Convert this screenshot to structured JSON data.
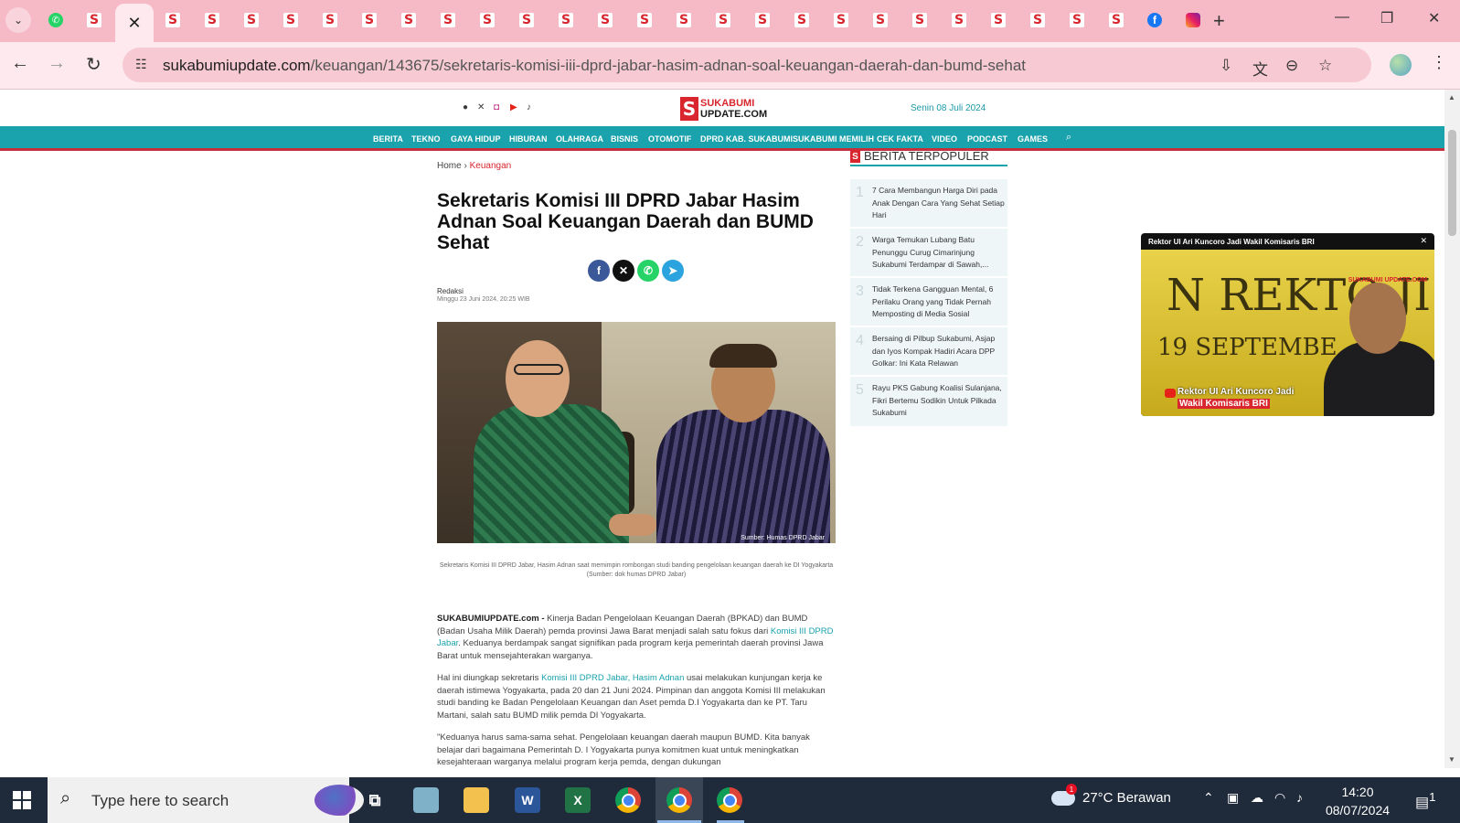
{
  "browser": {
    "url_domain": "sukabumiupdate.com",
    "url_path": "/keuangan/143675/sekretaris-komisi-iii-dprd-jabar-hasim-adnan-soal-keuangan-daerah-dan-bumd-sehat",
    "tab_icons": [
      "whatsapp-icon",
      "sukabumi-icon",
      "close-icon",
      "sukabumi-icon",
      "sukabumi-icon",
      "sukabumi-icon",
      "sukabumi-icon",
      "sukabumi-icon",
      "sukabumi-icon",
      "sukabumi-icon",
      "sukabumi-icon",
      "sukabumi-icon",
      "sukabumi-icon",
      "sukabumi-icon",
      "sukabumi-icon",
      "sukabumi-icon",
      "sukabumi-icon",
      "sukabumi-icon",
      "sukabumi-icon",
      "sukabumi-icon",
      "sukabumi-icon",
      "sukabumi-icon",
      "sukabumi-icon",
      "sukabumi-icon",
      "sukabumi-icon",
      "sukabumi-icon",
      "sukabumi-icon",
      "facebook-icon",
      "instagram-icon"
    ]
  },
  "site": {
    "logo_line1": "SUKABUMI",
    "logo_line2": "UPDATE.COM",
    "header_date": "Senin 08 Juli 2024",
    "nav": [
      "BERITA",
      "TEKNO",
      "GAYA HIDUP",
      "HIBURAN",
      "OLAHRAGA",
      "BISNIS",
      "OTOMOTIF",
      "DPRD KAB. SUKABUMI",
      "SUKABUMI MEMILIH",
      "CEK FAKTA",
      "VIDEO",
      "PODCAST",
      "GAMES"
    ]
  },
  "article": {
    "breadcrumb_home": "Home",
    "breadcrumb_sep": "›",
    "breadcrumb_current": "Keuangan",
    "title": "Sekretaris Komisi III DPRD Jabar Hasim Adnan Soal Keuangan Daerah dan BUMD Sehat",
    "author": "Redaksi",
    "date": "Minggu 23 Juni 2024, 20:25 WIB",
    "photo_credit": "Sumber: Humas DPRD Jabar",
    "caption": "Sekretaris Komisi III DPRD Jabar, Hasim Adnan saat memimpin rombongan studi banding pengelolaan keuangan daerah ke DI Yogyakarta (Sumber: dok humas DPRD Jabar)",
    "p1_lead": "SUKABUMIUPDATE.com -",
    "p1_a": " Kinerja Badan Pengelolaan Keuangan Daerah (BPKAD) dan BUMD (Badan Usaha Milik Daerah) pemda provinsi Jawa Barat menjadi salah satu fokus dari ",
    "p1_link": "Komisi III DPRD Jabar",
    "p1_b": ". Keduanya berdampak sangat signifikan pada program kerja pemerintah daerah provinsi Jawa Barat untuk mensejahterakan warganya.",
    "p2_a": "Hal ini diungkap sekretaris ",
    "p2_link1": "Komisi III DPRD Jabar",
    "p2_comma": ", ",
    "p2_link2": "Hasim Adnan",
    "p2_b": " usai melakukan kunjungan kerja ke daerah istimewa Yogyakarta, pada 20 dan 21 Juni 2024. Pimpinan dan anggota Komisi III melakukan studi banding ke Badan Pengelolaan Keuangan dan Aset pemda D.I Yogyakarta dan ke PT. Taru Martani, salah satu BUMD milik pemda DI Yogyakarta.",
    "p3": "\"Keduanya harus sama-sama sehat. Pengelolaan keuangan daerah maupun BUMD. Kita banyak belajar dari bagaimana Pemerintah D. I Yogyakarta punya komitmen kuat untuk meningkatkan kesejahteraan warganya melalui program kerja pemda, dengan dukungan"
  },
  "sidebar": {
    "heading": "BERITA TERPOPULER",
    "items": [
      {
        "num": "1",
        "title": "7 Cara Membangun Harga Diri pada Anak Dengan Cara Yang Sehat Setiap Hari"
      },
      {
        "num": "2",
        "title": "Warga Temukan Lubang Batu Penunggu Curug Cimarinjung Sukabumi Terdampar di Sawah,..."
      },
      {
        "num": "3",
        "title": "Tidak Terkena Gangguan Mental, 6 Perilaku Orang yang Tidak Pernah Memposting di Media Sosial"
      },
      {
        "num": "4",
        "title": "Bersaing di Pilbup Sukabumi, Asjap dan Iyos Kompak Hadiri Acara DPP Golkar: Ini Kata Relawan"
      },
      {
        "num": "5",
        "title": "Rayu PKS Gabung Koalisi Sulanjana, Fikri Bertemu Sodikin Untuk Pilkada Sukabumi"
      }
    ]
  },
  "video": {
    "title": "Rektor UI Ari Kuncoro Jadi Wakil Komisaris BRI",
    "bg_text1": "N REKTO  JI",
    "bg_text2": "19 SEPTEMBE",
    "watermark": "SUKABUMI UPDATE.COM",
    "caption1": "Rektor UI Ari Kuncoro Jadi",
    "caption2": "Wakil Komisaris BRI"
  },
  "taskbar": {
    "search_placeholder": "Type here to search",
    "weather_badge": "1",
    "weather": "27°C  Berawan",
    "time": "14:20",
    "date": "08/07/2024",
    "notif_count": "1"
  },
  "colors": {
    "accent_teal": "#1aa2ad",
    "accent_red": "#d9262e",
    "tabbar_pink": "#f6b9c6"
  }
}
